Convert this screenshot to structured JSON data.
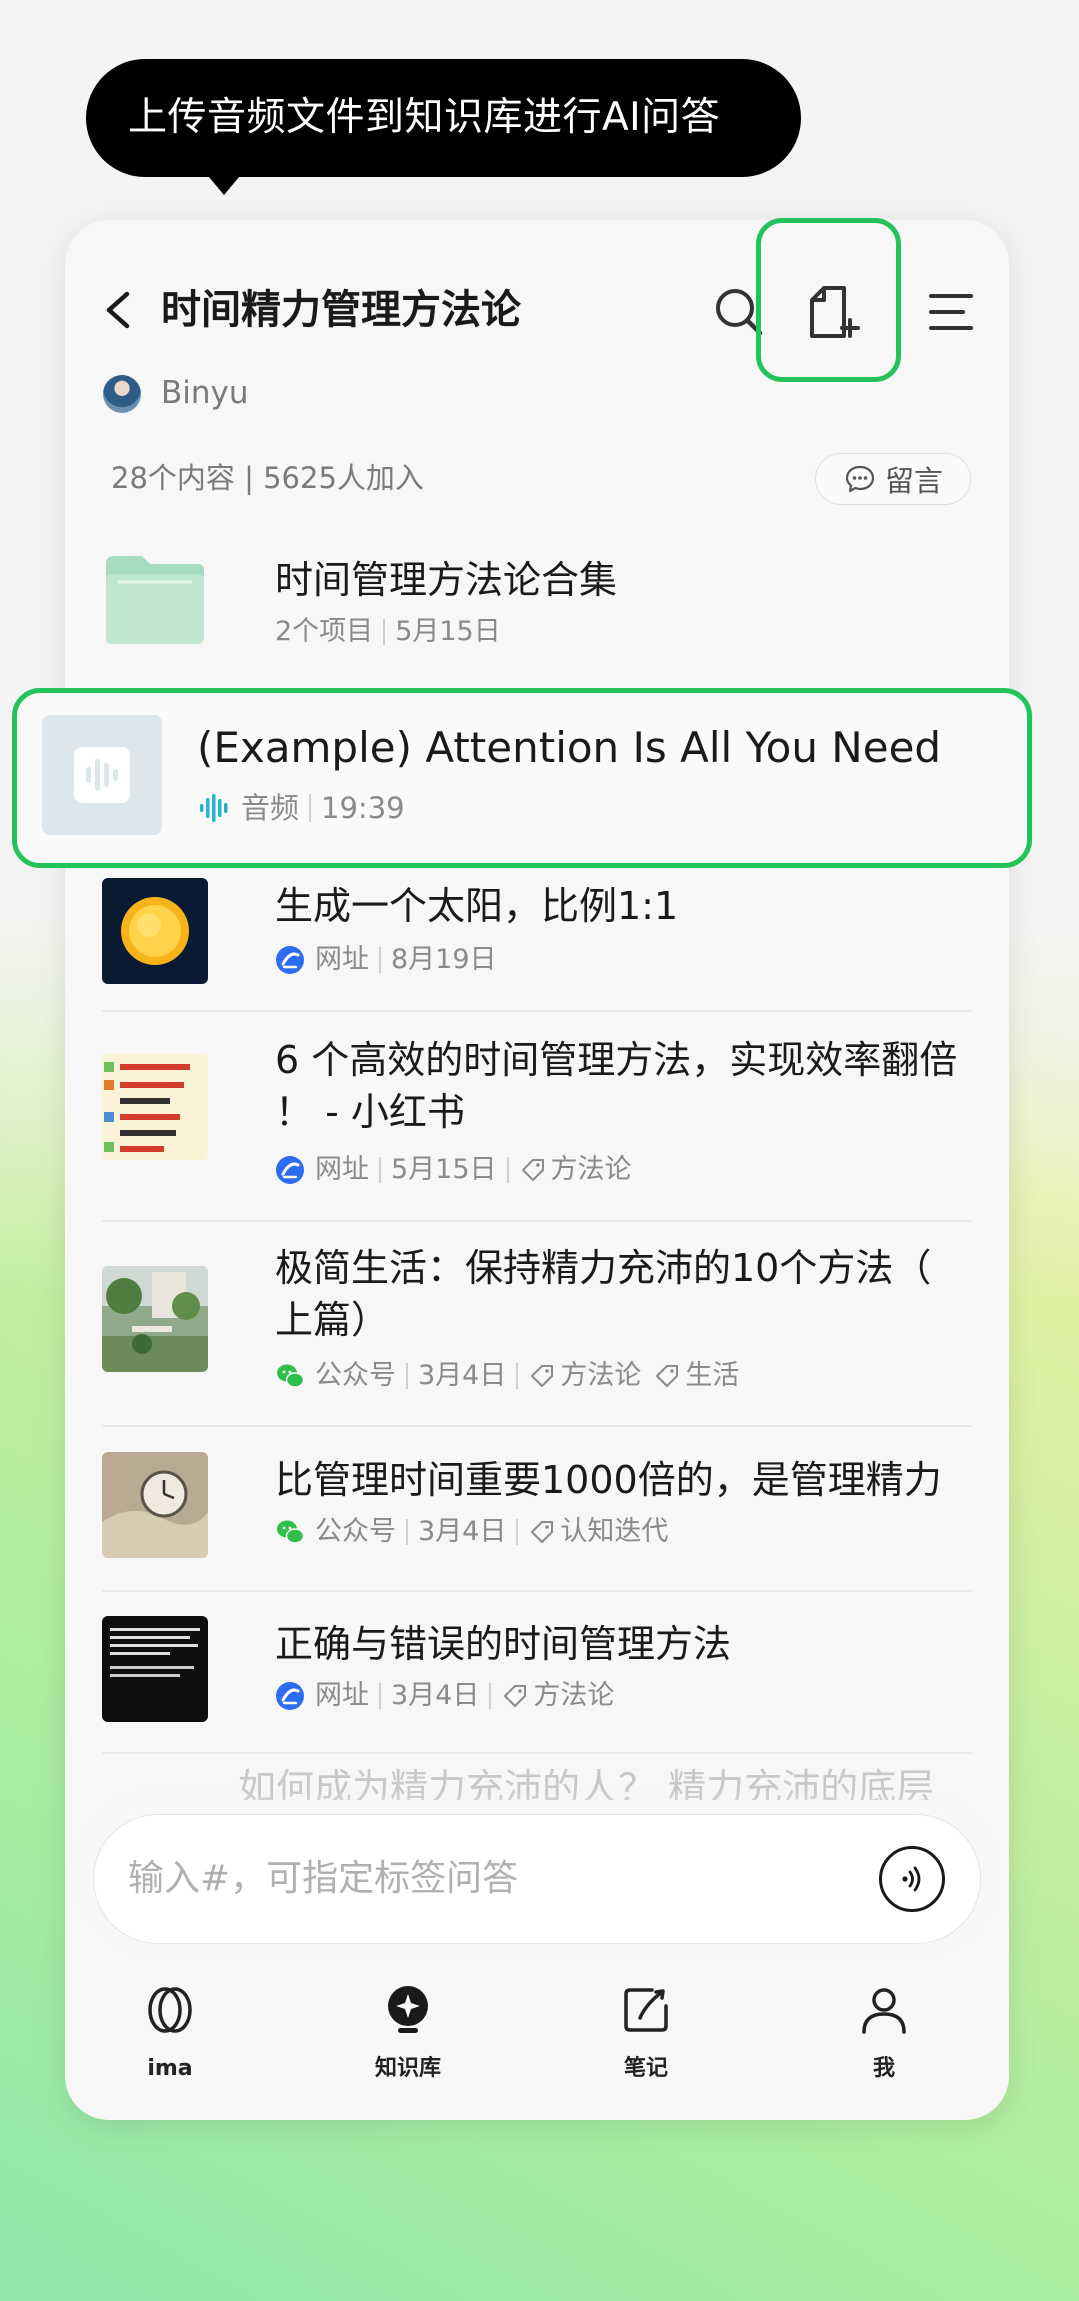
{
  "tooltip": {
    "text": "上传音频文件到知识库进行AI问答"
  },
  "header": {
    "title": "时间精力管理方法论",
    "author": "Binyu",
    "stats": "28个内容 | 5625人加入",
    "comment_label": "留言"
  },
  "items": [
    {
      "title": "时间管理方法论合集",
      "meta": [
        "2个项目",
        "5月15日"
      ],
      "tags": []
    },
    {
      "title": "(Example) Attention Is All You Need",
      "type": "音频",
      "duration": "19:39"
    },
    {
      "title": "生成一个太阳，比例1:1",
      "source": "网址",
      "date": "8月19日",
      "tags": []
    },
    {
      "title_line1": "6 个高效的时间管理方法，实现效率翻倍",
      "title_line2": "！ - 小红书",
      "source": "网址",
      "date": "5月15日",
      "tags": [
        "方法论"
      ]
    },
    {
      "title_line1": "极简生活：保持精力充沛的10个方法（",
      "title_line2": "上篇）",
      "source": "公众号",
      "date": "3月4日",
      "tags": [
        "方法论",
        "生活"
      ]
    },
    {
      "title": "比管理时间重要1000倍的，是管理精力",
      "source": "公众号",
      "date": "3月4日",
      "tags": [
        "认知迭代"
      ]
    },
    {
      "title": "正确与错误的时间管理方法",
      "source": "网址",
      "date": "3月4日",
      "tags": [
        "方法论"
      ]
    },
    {
      "title": "如何成为精力充沛的人？ 精力充沛的底层"
    }
  ],
  "input": {
    "placeholder": "输入#，可指定标签问答"
  },
  "tabs": [
    {
      "label": "ima",
      "icon": "ima-logo-icon"
    },
    {
      "label": "知识库",
      "icon": "knowledge-base-icon"
    },
    {
      "label": "笔记",
      "icon": "note-icon"
    },
    {
      "label": "我",
      "icon": "profile-icon"
    }
  ],
  "colors": {
    "highlight": "#22c35a",
    "link_source": "#2d6cf0",
    "wechat_source": "#2fbf4a",
    "audio_accent": "#27b0c8"
  }
}
